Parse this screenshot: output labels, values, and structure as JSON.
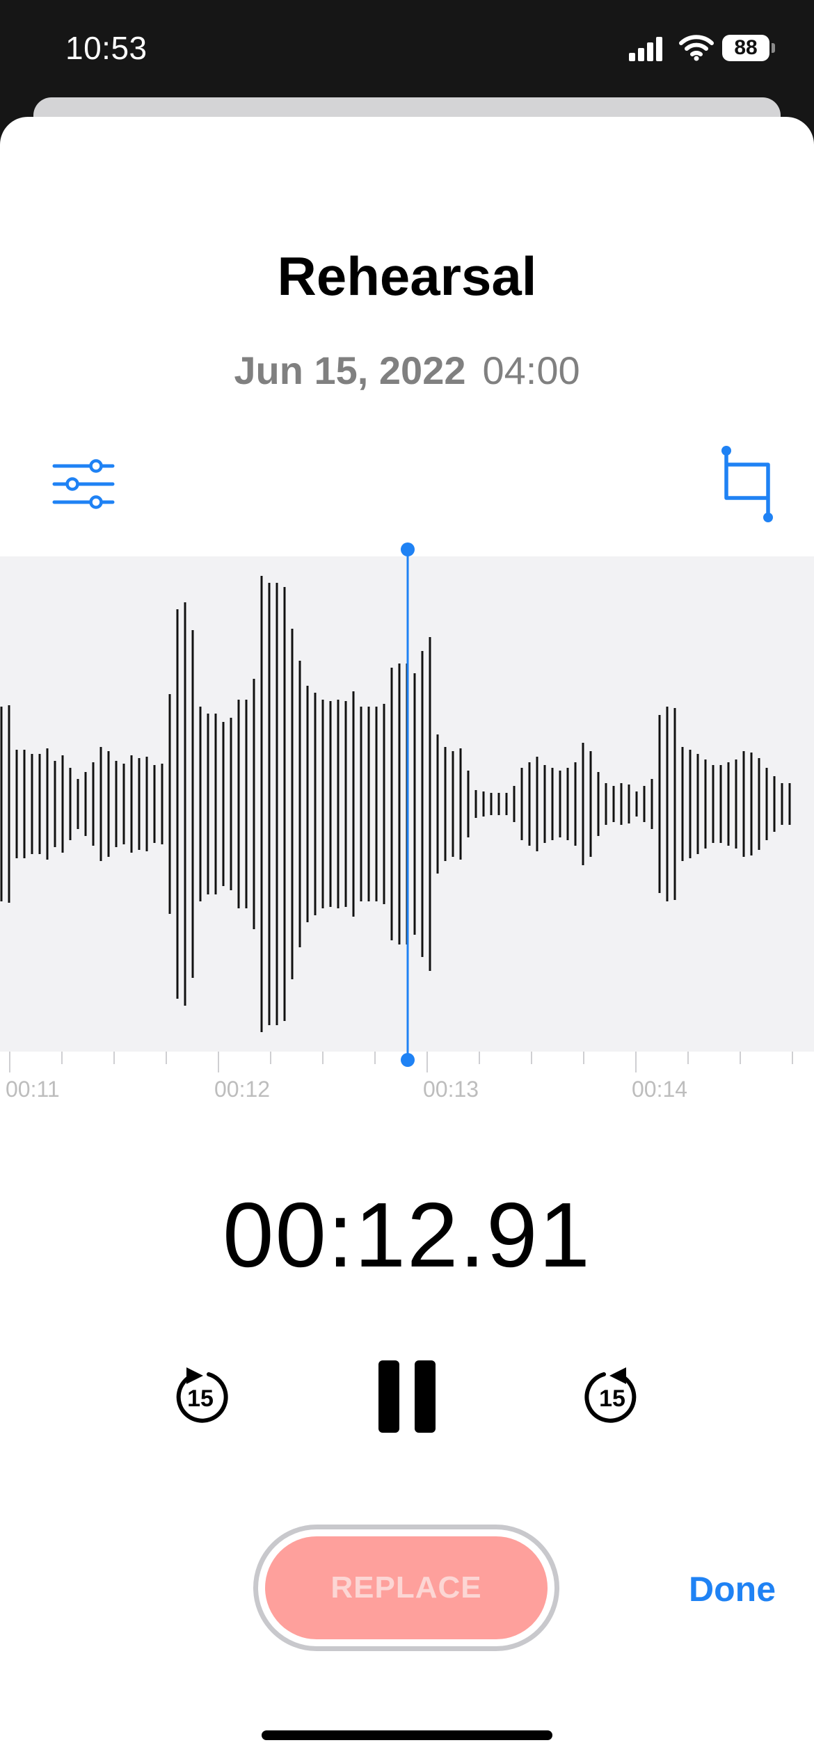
{
  "status_bar": {
    "time": "10:53",
    "battery": "88"
  },
  "recording": {
    "title": "Rehearsal",
    "date": "Jun 15, 2022",
    "duration": "04:00"
  },
  "timeline": {
    "labels": [
      "00:11",
      "00:12",
      "00:13",
      "00:14"
    ]
  },
  "playback": {
    "elapsed": "00:12.91",
    "skip_back": "15",
    "skip_forward": "15"
  },
  "actions": {
    "replace_label": "REPLACE",
    "done_label": "Done"
  },
  "colors": {
    "accent": "#1f82f4",
    "replace_bg": "#fea09c",
    "waveform_bg": "#f2f2f4"
  },
  "icons": [
    "signal-icon",
    "wifi-icon",
    "battery-icon",
    "settings-sliders-icon",
    "trim-crop-icon",
    "skip-back-15-icon",
    "pause-icon",
    "skip-forward-15-icon"
  ]
}
